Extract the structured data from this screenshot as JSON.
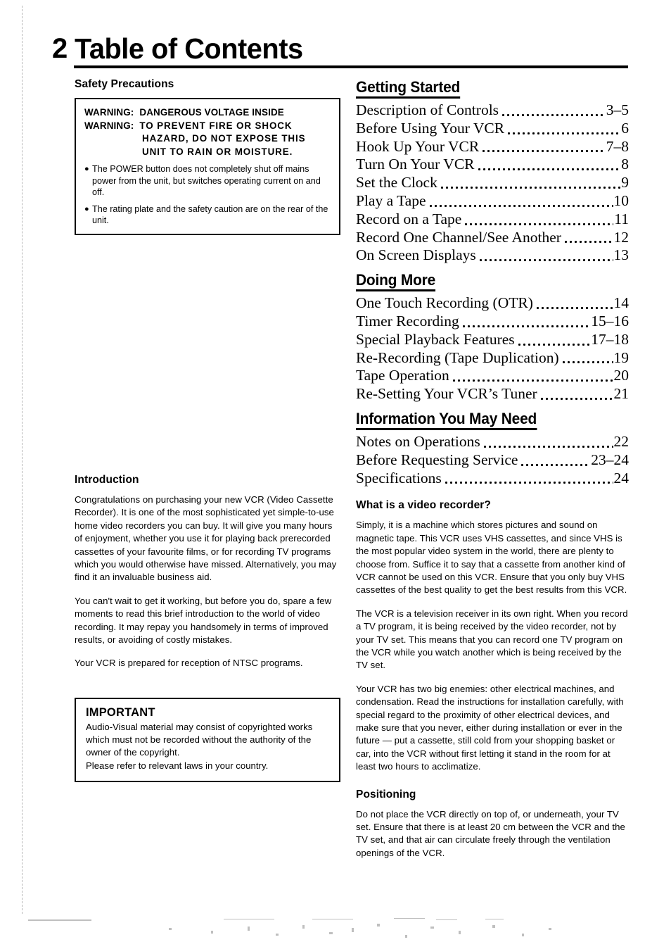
{
  "header": {
    "page_number": "2",
    "title": "Table of Contents"
  },
  "left_column": {
    "safety_heading": "Safety Precautions",
    "warning_box": {
      "rows": [
        {
          "label": "WARNING:",
          "text": "DANGEROUS VOLTAGE INSIDE"
        },
        {
          "label": "WARNING:",
          "text": "TO PREVENT FIRE OR SHOCK"
        }
      ],
      "continuation_lines": [
        "HAZARD, DO NOT EXPOSE THIS",
        "UNIT TO RAIN OR MOISTURE."
      ],
      "bullets": [
        "The POWER button does not completely shut off mains power from the unit, but switches operating current on and off.",
        "The rating plate and the safety caution are on the rear of the unit."
      ]
    },
    "introduction_heading": "Introduction",
    "introduction_paragraphs": [
      "Congratulations on purchasing your new VCR (Video Cassette Recorder). It is one of the most sophisticated yet simple-to-use home video recorders you can buy. It will give you many hours of enjoyment, whether you use it for playing back prerecorded cassettes of your favourite films, or for recording TV programs which you would otherwise have missed. Alternatively, you may find it an invaluable business aid.",
      "You can't wait to get it working, but before you do, spare a few moments to read this brief introduction to the world of video recording. It may repay you handsomely in terms of improved results, or avoiding of costly mistakes.",
      "Your VCR is prepared for reception of NTSC programs."
    ],
    "important_box": {
      "title": "IMPORTANT",
      "lines": [
        "Audio-Visual material may consist of copyrighted works which must not be recorded without the authority of the owner of the copyright.",
        "Please refer to relevant laws in your country."
      ]
    }
  },
  "right_column": {
    "toc_sections": [
      {
        "heading": "Getting Started",
        "entries": [
          {
            "label": "Description of Controls",
            "page": "3–5"
          },
          {
            "label": "Before Using Your VCR",
            "page": "6"
          },
          {
            "label": "Hook Up Your VCR",
            "page": "7–8"
          },
          {
            "label": "Turn On Your VCR",
            "page": "8"
          },
          {
            "label": "Set the Clock",
            "page": "9"
          },
          {
            "label": "Play a Tape",
            "page": "10"
          },
          {
            "label": "Record on a Tape",
            "page": "11"
          },
          {
            "label": "Record One Channel/See Another",
            "page": "12"
          },
          {
            "label": "On Screen Displays",
            "page": "13"
          }
        ]
      },
      {
        "heading": "Doing More",
        "entries": [
          {
            "label": "One Touch Recording (OTR)",
            "page": "14"
          },
          {
            "label": "Timer Recording",
            "page": "15–16"
          },
          {
            "label": "Special Playback Features",
            "page": "17–18"
          },
          {
            "label": "Re-Recording (Tape Duplication)",
            "page": "19"
          },
          {
            "label": "Tape Operation",
            "page": "20"
          },
          {
            "label": "Re-Setting Your VCR’s Tuner",
            "page": "21"
          }
        ]
      },
      {
        "heading": "Information You May Need",
        "entries": [
          {
            "label": "Notes on Operations",
            "page": "22"
          },
          {
            "label": "Before Requesting Service",
            "page": "23–24"
          },
          {
            "label": "Specifications",
            "page": "24"
          }
        ]
      }
    ],
    "what_is_heading": "What is a video recorder?",
    "what_is_paragraphs": [
      "Simply, it is a machine which stores pictures and sound on magnetic tape. This VCR uses VHS cassettes, and since VHS is the most popular video system in the world, there are plenty to choose from. Suffice it to say that a cassette from another kind of VCR cannot be used on this VCR. Ensure that you only buy VHS cassettes of the best quality to get the best results from this VCR.",
      "The VCR is a television receiver in its own right. When you record a TV program, it is being received by the video recorder, not by your TV set. This means that you can record one TV program on the VCR while you watch another which is being received by the TV set.",
      "Your VCR has two big enemies: other electrical machines, and condensation. Read the instructions for installation carefully, with special regard to the proximity of other electrical devices, and make sure that you never, either during installation or ever in the future — put a cassette, still cold from your shopping basket or car, into the VCR without first letting it stand in the room for at least two hours to acclimatize."
    ],
    "positioning_heading": "Positioning",
    "positioning_paragraphs": [
      "Do not place the VCR directly on top of, or underneath, your TV set. Ensure that there is at least 20 cm between the VCR and the TV set, and that air can circulate freely through the ventilation openings of the VCR."
    ]
  },
  "colors": {
    "ink": "#000000",
    "paper": "#ffffff"
  }
}
